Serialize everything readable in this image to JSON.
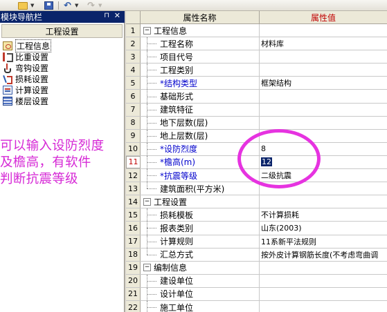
{
  "toolbar": {
    "icons": [
      "folder-open-icon",
      "save-icon",
      "undo-icon",
      "redo-icon"
    ]
  },
  "left_panel": {
    "title": "模块导航栏",
    "pin_glyph": "⊓",
    "close_glyph": "✕",
    "group_label": "工程设置",
    "items": [
      {
        "label": "工程信息",
        "icon": "project-info-icon"
      },
      {
        "label": "比重设置",
        "icon": "density-icon"
      },
      {
        "label": "弯钩设置",
        "icon": "hook-icon"
      },
      {
        "label": "损耗设置",
        "icon": "loss-icon"
      },
      {
        "label": "计算设置",
        "icon": "calc-icon"
      },
      {
        "label": "楼层设置",
        "icon": "floor-icon"
      }
    ],
    "note_lines": [
      "可以输入设防烈度",
      "及檐高，有软件",
      "判断抗震等级"
    ],
    "note_color": "#d629d6"
  },
  "grid": {
    "header_name": "属性名称",
    "header_value": "属性值",
    "rows": [
      {
        "idx": "1",
        "name": "工程信息",
        "value": "",
        "group": true
      },
      {
        "idx": "2",
        "name": "工程名称",
        "value": "材料库"
      },
      {
        "idx": "3",
        "name": "项目代号",
        "value": ""
      },
      {
        "idx": "4",
        "name": "工程类别",
        "value": ""
      },
      {
        "idx": "5",
        "name": "*结构类型",
        "value": "框架结构",
        "required": true
      },
      {
        "idx": "6",
        "name": "基础形式",
        "value": ""
      },
      {
        "idx": "7",
        "name": "建筑特征",
        "value": ""
      },
      {
        "idx": "8",
        "name": "地下层数(层)",
        "value": ""
      },
      {
        "idx": "9",
        "name": "地上层数(层)",
        "value": ""
      },
      {
        "idx": "10",
        "name": "*设防烈度",
        "value": "8",
        "required": true
      },
      {
        "idx": "11",
        "name": "*檐高(m)",
        "value": "12",
        "required": true,
        "selected": true
      },
      {
        "idx": "12",
        "name": "*抗震等级",
        "value": "二级抗震",
        "required": true
      },
      {
        "idx": "13",
        "name": "建筑面积(平方米)",
        "value": "",
        "last": true
      },
      {
        "idx": "14",
        "name": "工程设置",
        "value": "",
        "group": true
      },
      {
        "idx": "15",
        "name": "损耗模板",
        "value": "不计算损耗"
      },
      {
        "idx": "16",
        "name": "报表类别",
        "value": "山东(2003)"
      },
      {
        "idx": "17",
        "name": "计算规则",
        "value": "11系新平法规则"
      },
      {
        "idx": "18",
        "name": "汇总方式",
        "value": "按外皮计算钢筋长度(不考虑弯曲调",
        "last": true
      },
      {
        "idx": "19",
        "name": "编制信息",
        "value": "",
        "group": true
      },
      {
        "idx": "20",
        "name": "建设单位",
        "value": ""
      },
      {
        "idx": "21",
        "name": "设计单位",
        "value": ""
      },
      {
        "idx": "22",
        "name": "施工单位",
        "value": ""
      }
    ],
    "expander_glyph": "−"
  },
  "colors": {
    "title_bar": "#0a246a",
    "header_value_text": "#c00000",
    "required_text": "#0000cc",
    "annotation": "#e633e0"
  }
}
